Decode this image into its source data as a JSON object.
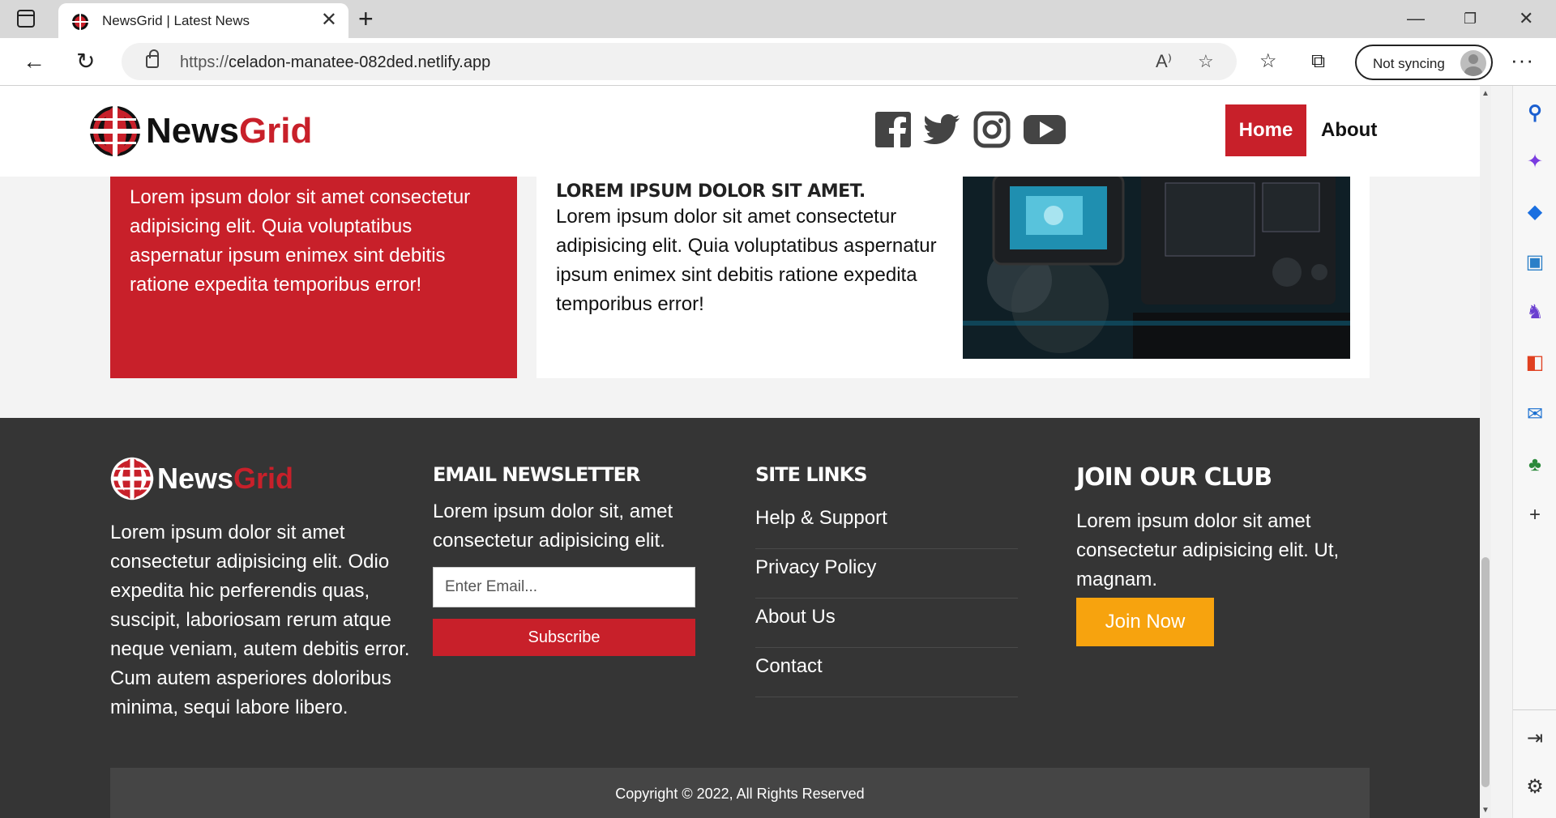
{
  "browser": {
    "tab_title": "NewsGrid | Latest News",
    "url_prefix": "https://",
    "url_host": "celadon-manatee-082ded.netlify.app",
    "sync_label": "Not syncing"
  },
  "site": {
    "brand_part1": "News",
    "brand_part2": "Grid",
    "nav": {
      "home": "Home",
      "about": "About"
    },
    "social": [
      "facebook-icon",
      "twitter-icon",
      "instagram-icon",
      "youtube-icon"
    ],
    "colors": {
      "brand_red": "#c8202a",
      "footer_bg": "#353535",
      "join_orange": "#f7a30e"
    }
  },
  "content": {
    "red_card_text": "Lorem ipsum dolor sit amet consectetur adipisicing elit. Quia voluptatibus aspernatur ipsum enimex sint debitis ratione expedita temporibus error!",
    "article_title": "LOREM IPSUM DOLOR SIT AMET.",
    "article_text": "Lorem ipsum dolor sit amet consectetur adipisicing elit. Quia voluptatibus aspernatur ipsum enimex sint debitis ratione expedita temporibus error!"
  },
  "footer": {
    "about_text": "Lorem ipsum dolor sit amet consectetur adipisicing elit. Odio expedita hic perferendis quas, suscipit, laboriosam rerum atque neque veniam, autem debitis error. Cum autem asperiores doloribus minima, sequi labore libero.",
    "newsletter_heading": "EMAIL NEWSLETTER",
    "newsletter_text": "Lorem ipsum dolor sit, amet consectetur adipisicing elit.",
    "email_placeholder": "Enter Email...",
    "subscribe_label": "Subscribe",
    "links_heading": "SITE LINKS",
    "links": [
      "Help & Support",
      "Privacy Policy",
      "About Us",
      "Contact"
    ],
    "club_heading": "JOIN OUR CLUB",
    "club_text": "Lorem ipsum dolor sit amet consectetur adipisicing elit. Ut, magnam.",
    "join_label": "Join Now",
    "copyright": "Copyright © 2022, All Rights Reserved"
  }
}
